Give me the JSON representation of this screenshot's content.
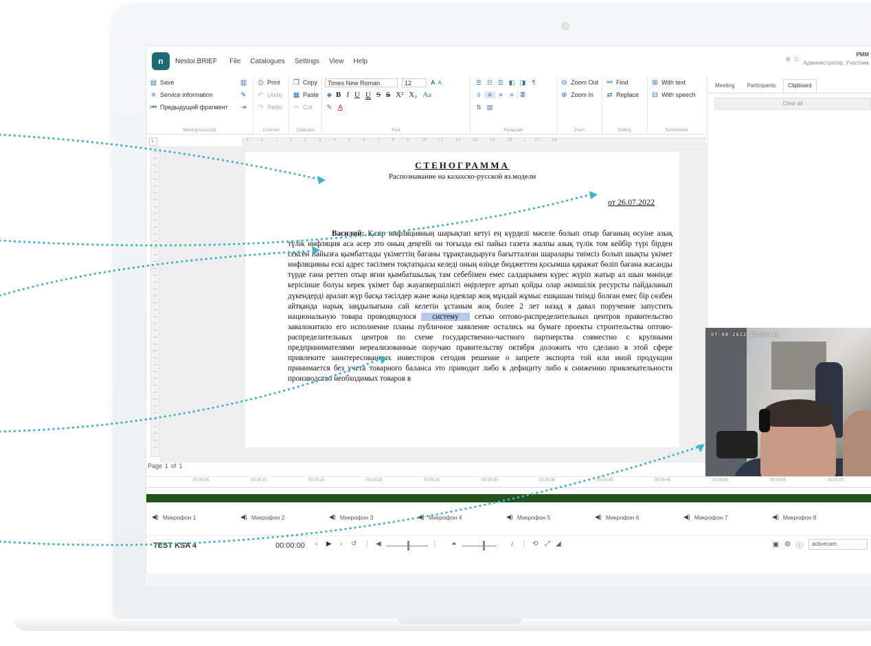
{
  "app": {
    "name": "Nestor.BRIEF",
    "logo_text": "n",
    "menu": [
      "File",
      "Catalogues",
      "Settings",
      "View",
      "Help"
    ],
    "top_right": {
      "user": "Администратор, Участник",
      "initials": "PMM"
    }
  },
  "ribbon": {
    "meeting_transcript": {
      "label": "Meeting transcript",
      "save": "Save",
      "service_info": "Service information",
      "previous_fragment": "Предыдущий фрагмент"
    },
    "common": {
      "label": "Common",
      "print": "Print",
      "undo": "Undo",
      "redo": "Redo"
    },
    "clipboard": {
      "label": "Clipboard",
      "copy": "Copy",
      "paste": "Paste",
      "cut": "Cut"
    },
    "font": {
      "label": "Font",
      "family": "Times New Roman",
      "size": "12",
      "formats": [
        "B",
        "I",
        "U",
        "U",
        "S",
        "S",
        "X²",
        "X₂",
        "Aa"
      ]
    },
    "paragraph": {
      "label": "Paragraph"
    },
    "zoom": {
      "label": "Zoom",
      "zoom_out": "Zoom Out",
      "zoom_in": "Zoom In"
    },
    "editing": {
      "label": "Editing",
      "find": "Find",
      "replace": "Replace"
    },
    "synchronize": {
      "label": "Synchronize",
      "with_text": "With text",
      "with_speech": "With speech"
    }
  },
  "side_panel": {
    "tabs": [
      "Meeting",
      "Participants",
      "Clipboard"
    ],
    "active_tab": "Clipboard",
    "clear_all": "Clear all"
  },
  "document": {
    "title": "СТЕНОГРАММА",
    "subtitle": "Распознавание на казахско-русской яз.модели",
    "date": "от 26.07.2022",
    "speaker": "Василий:",
    "text_before": "Қазір инфляцияның шарықтап кетуі ең күрделі мәселе болып отыр бағаның өсуіне азық түлік инфляция аса әсер это оның деңгейі он тоғызда екі пайыз газета жалпы азық түлік том кейбір түрі бірден сексен пайызға қымбаттады үкіметтің бағаны тұрақтандыруға бағытталған шаралары тиімсіз болып шықты үкімет инфляцияны ескі адрес тәсілмен тоқтатқысы келеді оның өзінде бюджеттен қосымша қаражат бөліп бағана жасанды түрде ғана реттеп отыр яғни қымбатшылық там себебімен емес салдарымен күрес жүріп жатыр ал шын мәнінде керісінше болуы керек үкімет бар жауапкершілікті өңірлерге артып қойды олар әкімшілік ресурсты пайдаланып дүкендерді аралап жүр басқа тәсілдер және жаңа идеялар жоқ мұндай жұмыс ешқашан тиімді болған емес бір сөзбен айтқанда нарық заңдылығына сай келетін ұстаным жоқ более 2 лет назад я давал поручение запустить национальную товара проводящуюся",
    "highlight": "систему",
    "text_after": "сетью оптово-распределительных центров правительство завалокитило его исполнение планы публичное заявление остались на бумаге проекты строительства оптово-распределительных центров по схеме государственно-частного партнерства совместно с крупными предпринимателями нереализованные поручаю правительству октября доложить что сделано в этой сфере привлеките заинтересованных инвесторов сегодня решение о запрете экспорта той или иной продукции принимается без учета товарного баланса это приводит либо к дефициту либо к снижению привлекательности производство необходимых товаров в"
  },
  "page_indicator": {
    "page": "Page",
    "current": "1",
    "of": "of",
    "total": "1"
  },
  "video": {
    "timestamp": "07-08-2022 11:09:12"
  },
  "timeline": {
    "ticks": [
      "00:00:05",
      "00:00:10",
      "00:00:15",
      "00:00:20",
      "00:00:25",
      "00:00:30",
      "00:00:35",
      "00:00:40",
      "00:00:45",
      "00:00:50",
      "00:00:55",
      "00:01:00"
    ]
  },
  "mics": [
    "Микрофон 1",
    "Микрофон 2",
    "Микрофон 3",
    "Микрофон 4",
    "Микрофон 5",
    "Микрофон 6",
    "Микрофон 7",
    "Микрофон 8"
  ],
  "player": {
    "track": "TEST KSA 4",
    "time": "00:00:00",
    "camera_field": "activecam"
  },
  "colors": {
    "accent": "#2a6fb0",
    "waveform": "#24521a",
    "callout": "#3ab6c8",
    "highlight": "#b9c8ee"
  }
}
